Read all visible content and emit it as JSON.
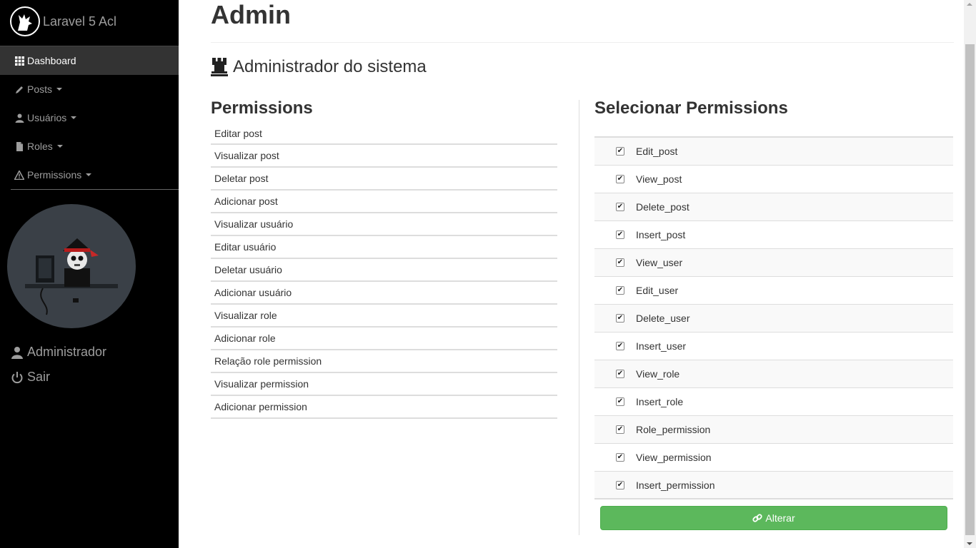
{
  "sidebar": {
    "brand": "Laravel 5 Acl",
    "nav": [
      {
        "label": "Dashboard",
        "icon": "grid-icon",
        "active": true
      },
      {
        "label": "Posts",
        "icon": "pencil-icon",
        "dropdown": true
      },
      {
        "label": "Usuários",
        "icon": "user-icon",
        "dropdown": true
      },
      {
        "label": "Roles",
        "icon": "file-icon",
        "dropdown": true
      },
      {
        "label": "Permissions",
        "icon": "warning-icon",
        "dropdown": true
      }
    ],
    "user_name": "Administrador",
    "logout": "Sair"
  },
  "main": {
    "title": "Admin",
    "role_heading": "Administrador do sistema",
    "permissions_heading": "Permissions",
    "permissions": [
      "Editar post",
      "Visualizar post",
      "Deletar post",
      "Adicionar post",
      "Visualizar usuário",
      "Editar usuário",
      "Deletar usuário",
      "Adicionar usuário",
      "Visualizar role",
      "Adicionar role",
      "Relação role permission",
      "Visualizar permission",
      "Adicionar permission"
    ],
    "select_heading": "Selecionar Permissions",
    "select_items": [
      {
        "label": "Edit_post",
        "checked": true
      },
      {
        "label": "View_post",
        "checked": true
      },
      {
        "label": "Delete_post",
        "checked": true
      },
      {
        "label": "Insert_post",
        "checked": true
      },
      {
        "label": "View_user",
        "checked": true
      },
      {
        "label": "Edit_user",
        "checked": true
      },
      {
        "label": "Delete_user",
        "checked": true
      },
      {
        "label": "Insert_user",
        "checked": true
      },
      {
        "label": "View_role",
        "checked": true
      },
      {
        "label": "Insert_role",
        "checked": true
      },
      {
        "label": "Role_permission",
        "checked": true
      },
      {
        "label": "View_permission",
        "checked": true
      },
      {
        "label": "Insert_permission",
        "checked": true
      }
    ],
    "submit_label": "Alterar"
  },
  "colors": {
    "sidebar_bg": "#000000",
    "sidebar_active": "#333333",
    "success": "#5cb85c"
  }
}
